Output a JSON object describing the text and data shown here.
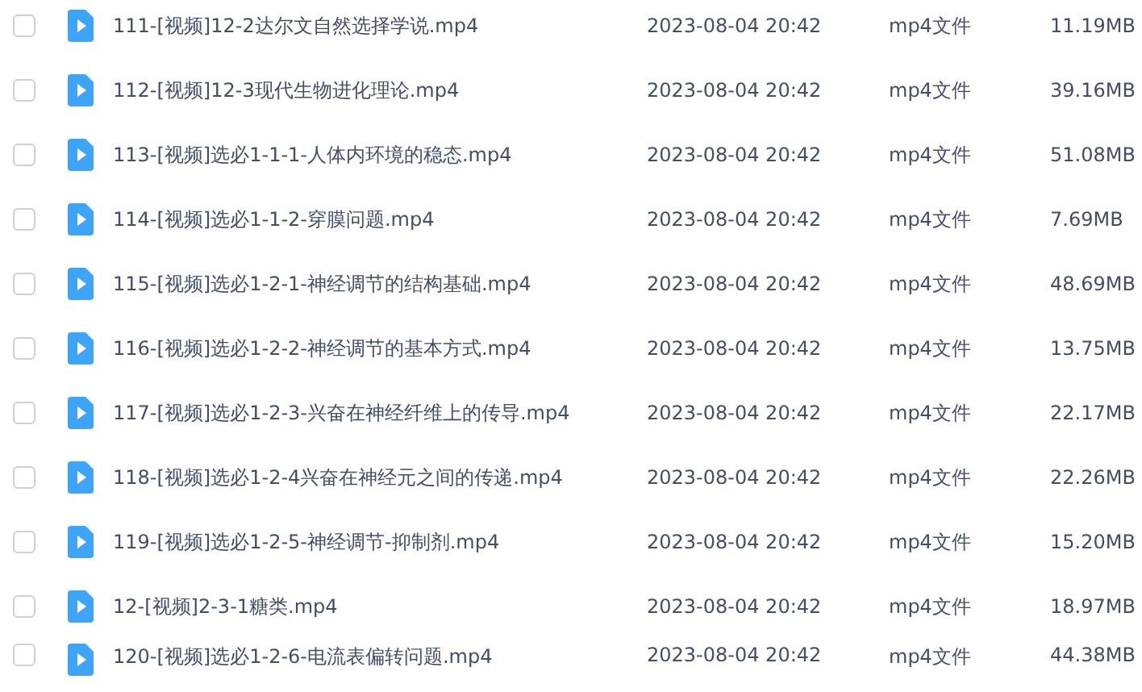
{
  "files": [
    {
      "name": "111-[视频]12-2达尔文自然选择学说.mp4",
      "modified": "2023-08-04 20:42",
      "type": "mp4文件",
      "size": "11.19MB",
      "checked": false
    },
    {
      "name": "112-[视频]12-3现代生物进化理论.mp4",
      "modified": "2023-08-04 20:42",
      "type": "mp4文件",
      "size": "39.16MB",
      "checked": false
    },
    {
      "name": "113-[视频]选必1-1-1-人体内环境的稳态.mp4",
      "modified": "2023-08-04 20:42",
      "type": "mp4文件",
      "size": "51.08MB",
      "checked": false
    },
    {
      "name": "114-[视频]选必1-1-2-穿膜问题.mp4",
      "modified": "2023-08-04 20:42",
      "type": "mp4文件",
      "size": "7.69MB",
      "checked": false
    },
    {
      "name": "115-[视频]选必1-2-1-神经调节的结构基础.mp4",
      "modified": "2023-08-04 20:42",
      "type": "mp4文件",
      "size": "48.69MB",
      "checked": false
    },
    {
      "name": "116-[视频]选必1-2-2-神经调节的基本方式.mp4",
      "modified": "2023-08-04 20:42",
      "type": "mp4文件",
      "size": "13.75MB",
      "checked": false
    },
    {
      "name": "117-[视频]选必1-2-3-兴奋在神经纤维上的传导.mp4",
      "modified": "2023-08-04 20:42",
      "type": "mp4文件",
      "size": "22.17MB",
      "checked": false
    },
    {
      "name": "118-[视频]选必1-2-4兴奋在神经元之间的传递.mp4",
      "modified": "2023-08-04 20:42",
      "type": "mp4文件",
      "size": "22.26MB",
      "checked": false
    },
    {
      "name": "119-[视频]选必1-2-5-神经调节-抑制剂.mp4",
      "modified": "2023-08-04 20:42",
      "type": "mp4文件",
      "size": "15.20MB",
      "checked": false
    },
    {
      "name": "12-[视频]2-3-1糖类.mp4",
      "modified": "2023-08-04 20:42",
      "type": "mp4文件",
      "size": "18.97MB",
      "checked": false
    },
    {
      "name": "120-[视频]选必1-2-6-电流表偏转问题.mp4",
      "modified": "2023-08-04 20:42",
      "type": "mp4文件",
      "size": "44.38MB",
      "checked": false
    }
  ]
}
